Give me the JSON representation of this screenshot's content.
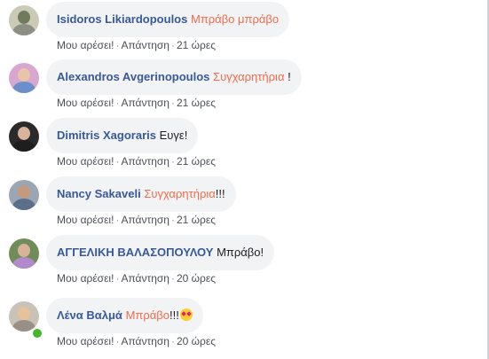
{
  "comments": [
    {
      "author": "Isidoros Likiardopoulos",
      "highlight": "Μπράβο μπράβο",
      "text_after": "",
      "like_label": "Μου αρέσει!",
      "reply_label": "Απάντηση",
      "time": "21 ώρες",
      "avatar_colors": [
        "#c9cbb5",
        "#6f7a5e",
        "#8d8f84"
      ],
      "online": false
    },
    {
      "author": "Alexandros Avgerinopoulos",
      "highlight": "Συγχαρητήρια",
      "text_after": " !",
      "like_label": "Μου αρέσει!",
      "reply_label": "Απάντηση",
      "time": "21 ώρες",
      "avatar_colors": [
        "#d7a6d1",
        "#e8c4a8",
        "#6a8fc9"
      ],
      "online": false
    },
    {
      "author": "Dimitris Xagoraris",
      "highlight": "",
      "text_after": " Ευγε!",
      "like_label": "Μου αρέσει!",
      "reply_label": "Απάντηση",
      "time": "21 ώρες",
      "avatar_colors": [
        "#2a2a2a",
        "#d9b49a",
        "#1e1e1e"
      ],
      "online": false
    },
    {
      "author": "Nancy Sakaveli",
      "highlight": "Συγχαρητήρια",
      "text_after": "!!!",
      "like_label": "Μου αρέσει!",
      "reply_label": "Απάντηση",
      "time": "21 ώρες",
      "avatar_colors": [
        "#9aa6b3",
        "#c49a7e",
        "#5b6f8a"
      ],
      "online": false
    },
    {
      "author": "ΑΓΓΕΛΙΚΗ ΒΑΛΑΣΟΠΟΥΛΟΥ",
      "highlight": "",
      "text_after": " Μπράβο!",
      "like_label": "Μου αρέσει!",
      "reply_label": "Απάντηση",
      "time": "20 ώρες",
      "avatar_colors": [
        "#6f8c5a",
        "#d8b39a",
        "#b28ac9"
      ],
      "online": false
    },
    {
      "author": "Λένα Βαλμά",
      "highlight": "Μπράβο",
      "text_after": "!!!",
      "like_label": "Μου αρέσει!",
      "reply_label": "Απάντηση",
      "time": "20 ώρες",
      "avatar_colors": [
        "#c8c2b8",
        "#e6c19a",
        "#9a8f86"
      ],
      "online": true,
      "emoji": "heart-eyes-emoji"
    }
  ],
  "colors": {
    "author": "#385898",
    "highlight": "#f36b4a",
    "bubble": "#f2f3f5",
    "meta": "#606770",
    "online": "#42b72a"
  }
}
